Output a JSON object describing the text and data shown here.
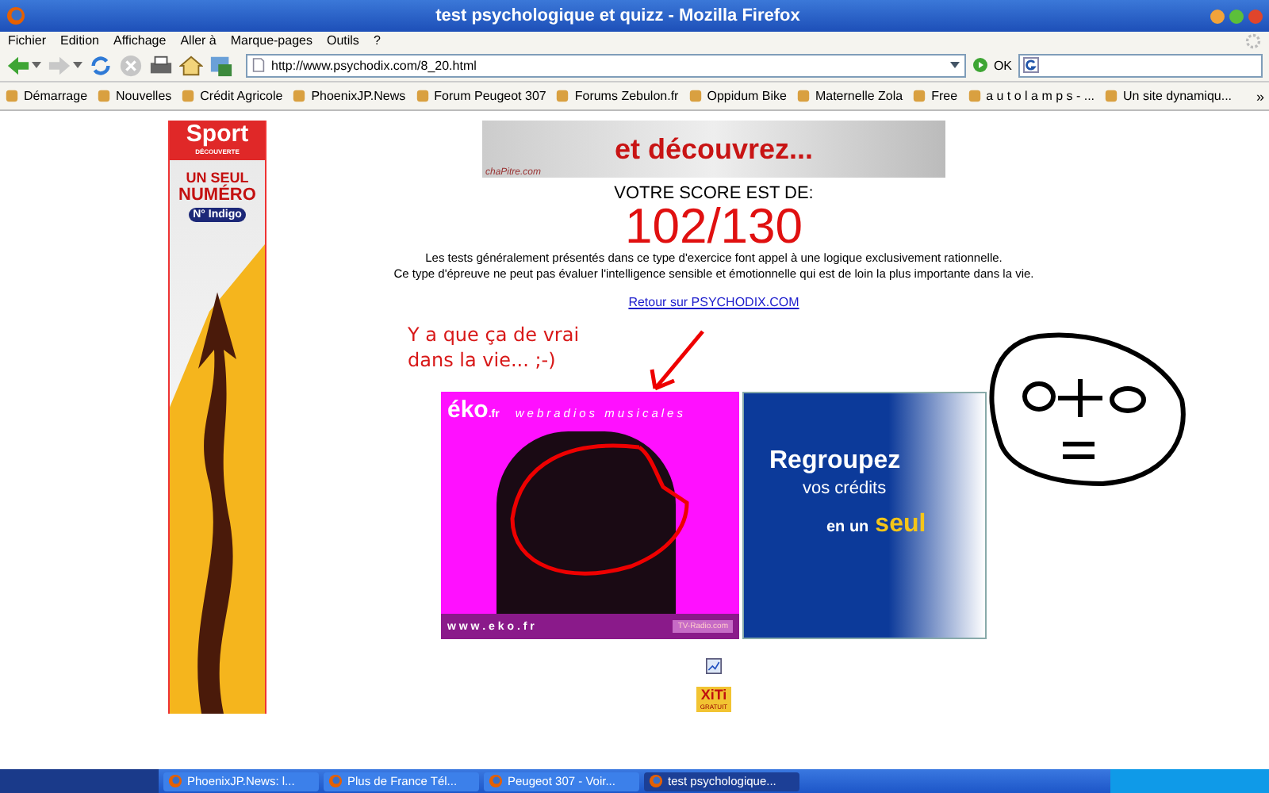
{
  "window": {
    "title": "test psychologique et quizz - Mozilla Firefox"
  },
  "menu": [
    "Fichier",
    "Edition",
    "Affichage",
    "Aller à",
    "Marque-pages",
    "Outils",
    "?"
  ],
  "toolbar": {
    "address": "http://www.psychodix.com/8_20.html",
    "go": "OK"
  },
  "bookmarks": [
    "Démarrage",
    "Nouvelles",
    "Crédit Agricole",
    "PhoenixJP.News",
    "Forum Peugeot 307",
    "Forums Zebulon.fr",
    "Oppidum Bike",
    "Maternelle Zola",
    "Free",
    "a u t o l a m p s - ...",
    "Un site dynamiqu..."
  ],
  "bookmarks_more": "»",
  "page": {
    "side_ad": {
      "brand": "Sport",
      "sub": "DÉCOUVERTE",
      "line1": "UN SEUL",
      "line2": "NUMÉRO",
      "badge": "N° Indigo"
    },
    "top_banner": {
      "headline": "et découvrez...",
      "brand": "chaPitre.com"
    },
    "score_label": "VOTRE SCORE EST DE:",
    "score": "102/130",
    "text_lines": [
      "Les tests généralement présentés dans ce type d'exercice font appel à une logique exclusivement rationnelle.",
      "Ce type d'épreuve ne peut pas évaluer l'intelligence sensible et émotionnelle qui est de loin la plus importante dans la vie."
    ],
    "link": "Retour sur PSYCHODIX.COM",
    "annotation": [
      "Y a que ça de vrai",
      "dans la vie... ;-)"
    ],
    "eko_ad": {
      "logo": "éko",
      "tld": ".fr",
      "tagline": "webradios musicales",
      "url": "w w w . e k o . f r",
      "partner": "TV-Radio.com"
    },
    "credit_ad": {
      "line1": "Regroupez",
      "line2": "vos crédits",
      "line3": "en un",
      "line4": "seul"
    },
    "counter": {
      "label": "XiTi",
      "sub": "GRATUIT"
    }
  },
  "taskbar": [
    {
      "label": "PhoenixJP.News: l...",
      "selected": false
    },
    {
      "label": "Plus de France Tél...",
      "selected": false
    },
    {
      "label": "Peugeot 307 - Voir...",
      "selected": false
    },
    {
      "label": "test psychologique...",
      "selected": true
    }
  ]
}
